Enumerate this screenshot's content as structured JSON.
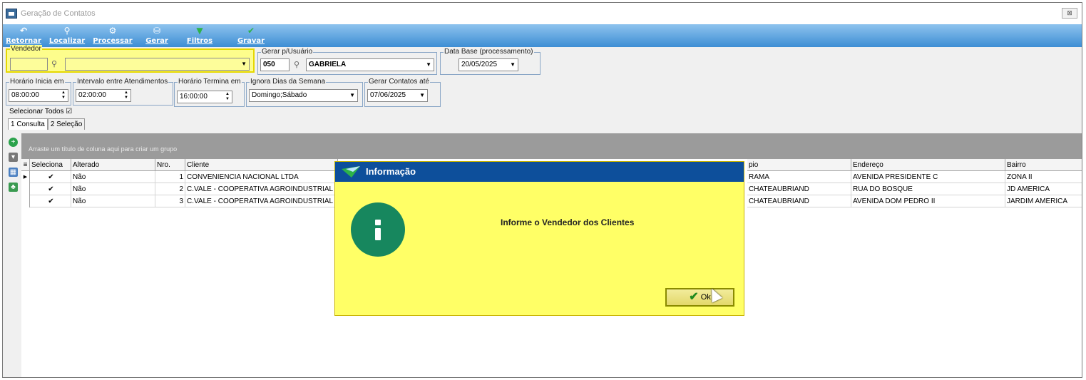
{
  "window": {
    "title": "Geração de Contatos",
    "close": "⊠"
  },
  "toolbar": [
    {
      "label": "Retornar",
      "icon": "↶"
    },
    {
      "label": "Localizar",
      "icon": "⚲"
    },
    {
      "label": "Processar",
      "icon": "⚙"
    },
    {
      "label": "Gerar",
      "icon": "⛁"
    },
    {
      "label": "Filtros",
      "icon": "▼"
    },
    {
      "label": "Gravar",
      "icon": "✔"
    }
  ],
  "vendedor": {
    "legend": "Vendedor",
    "code": "",
    "name": ""
  },
  "gerar_usuario": {
    "legend": "Gerar p/Usuário",
    "code": "050",
    "name": "GABRIELA"
  },
  "data_base": {
    "legend": "Data Base (processamento)",
    "value": "20/05/2025"
  },
  "horario_inicia": {
    "legend": "Horário Inicia em",
    "value": "08:00:00"
  },
  "intervalo": {
    "legend": "Intervalo entre Atendimentos",
    "value": "02:00:00"
  },
  "horario_termina": {
    "legend": "Horário Termina em",
    "value": "16:00:00"
  },
  "ignora_dias": {
    "legend": "Ignora Dias da Semana",
    "value": "Domingo;Sábado"
  },
  "gerar_ate": {
    "legend": "Gerar Contatos até",
    "value": "07/06/2025"
  },
  "select_all": "Selecionar Todos ☑",
  "tabs": [
    "1 Consulta",
    "2 Seleção"
  ],
  "group_hint": "Arraste um título de coluna aqui para criar um grupo",
  "columns": [
    "Seleciona",
    "Alterado",
    "Nro.",
    "Cliente",
    "pio",
    "Endereço",
    "Bairro"
  ],
  "rows": [
    {
      "sel": "✔",
      "alterado": "Não",
      "nro": "1",
      "cliente": "CONVENIENCIA NACIONAL LTDA",
      "pio": "RAMA",
      "endereco": "AVENIDA PRESIDENTE C",
      "bairro": "ZONA II"
    },
    {
      "sel": "✔",
      "alterado": "Não",
      "nro": "2",
      "cliente": "C.VALE - COOPERATIVA AGROINDUSTRIAL",
      "pio": "CHATEAUBRIAND",
      "endereco": "RUA DO BOSQUE",
      "bairro": "JD AMERICA"
    },
    {
      "sel": "✔",
      "alterado": "Não",
      "nro": "3",
      "cliente": "C.VALE - COOPERATIVA AGROINDUSTRIAL",
      "pio": "CHATEAUBRIAND",
      "endereco": "AVENIDA DOM PEDRO II",
      "bairro": "JARDIM AMERICA"
    }
  ],
  "dialog": {
    "title": "Informação",
    "message": "Informe o Vendedor dos Clientes",
    "ok_label": "Ok"
  },
  "colors": {
    "toolbar": "#3d8ed4",
    "highlight": "#fdfd8c",
    "dialog_bg": "#ffff66",
    "dialog_header": "#0d4f9b",
    "info_icon": "#17875e"
  }
}
